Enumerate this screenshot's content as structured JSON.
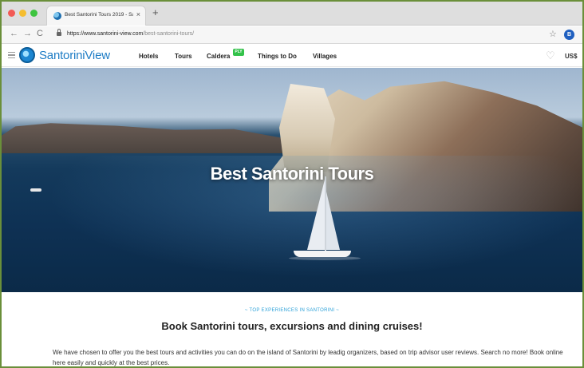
{
  "browser": {
    "tab_title": "Best Santorini Tours 2019 - Sa",
    "url_host": "https://www.santorini-view.com",
    "url_path": "/best-santorini-tours/",
    "profile_initial": "B"
  },
  "site": {
    "logo_text": "SantoriniView",
    "nav": [
      "Hotels",
      "Tours",
      "Caldera",
      "Things to Do",
      "Villages"
    ],
    "caldera_badge": "PLY",
    "currency": "US$"
  },
  "hero": {
    "title": "Best Santorini Tours"
  },
  "content": {
    "kicker": "~ TOP EXPERIENCES IN SANTORINI ~",
    "headline": "Book Santorini tours, excursions and dining cruises!",
    "intro": "We have chosen to offer you the best tours and activities you can do on the island of Santorini by leadig organizers, based on trip advisor user reviews. Search no more! Book online here easily and quickly at the best prices."
  },
  "icons": {
    "favicon": "santorini-view-favicon",
    "back": "back-arrow-icon",
    "forward": "forward-arrow-icon",
    "reload": "reload-icon",
    "lock": "lock-icon",
    "bookmark": "star-icon",
    "menu": "hamburger-menu-icon",
    "wishlist": "heart-icon"
  },
  "colors": {
    "brand": "#1d7cc5",
    "kicker": "#2aa0d8",
    "badge": "#33c24a"
  }
}
